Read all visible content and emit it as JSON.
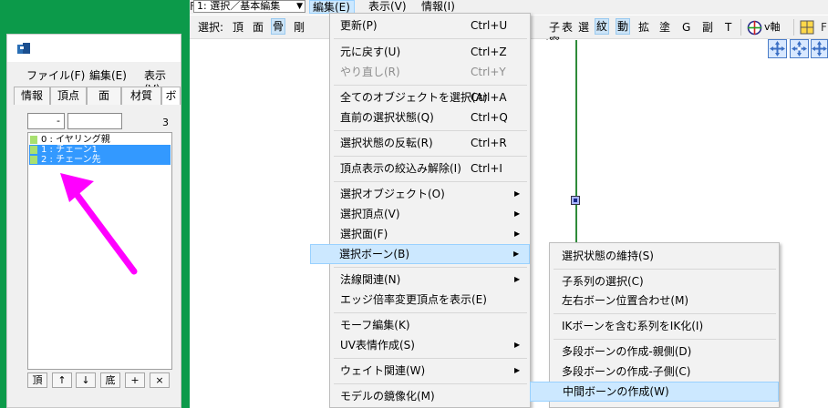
{
  "colors": {
    "green_bg": "#0c9a4a",
    "highlight": "#cce8ff",
    "list_selection": "#3399ff",
    "arrow": "#ff00ff",
    "axis": "#2e8b3a"
  },
  "topbar": {
    "mode_select": "1: 選択／基本編集",
    "menus": {
      "edit": "編集(E)",
      "view": "表示(V)",
      "info": "情報(I)"
    },
    "cut_left": "F",
    "cut_right": "F"
  },
  "select_toolbar": {
    "label": "選択:",
    "left": [
      "頂",
      "面",
      "骨",
      "剛"
    ],
    "window_label": "子窓:",
    "right": [
      "表",
      "選",
      "紋",
      "動",
      "拡",
      "塗",
      "G",
      "副",
      "T"
    ],
    "v_axis": "v軸"
  },
  "bone_panel": {
    "menus": [
      "ファイル(F)",
      "編集(E)",
      "表示(V)"
    ],
    "tabs": [
      "情報",
      "頂点",
      "面",
      "材質",
      "ボ"
    ],
    "field_a": "-",
    "field_b": "",
    "count": "3",
    "bones": [
      {
        "label": "0 : イヤリング親",
        "color": "#a8e070"
      },
      {
        "label": "1 : チェーン1",
        "color": "#a8e070"
      },
      {
        "label": "2 : チェーン先",
        "color": "#a8e070"
      }
    ],
    "buttons": [
      "頂",
      "↑",
      "↓",
      "底",
      "+",
      "×"
    ]
  },
  "edit_menu": {
    "items": [
      {
        "label": "更新(P)",
        "shortcut": "Ctrl+U"
      },
      {
        "label": "元に戻す(U)",
        "shortcut": "Ctrl+Z"
      },
      {
        "label": "やり直し(R)",
        "shortcut": "Ctrl+Y"
      },
      {
        "label": "全てのオブジェクトを選択(A)",
        "shortcut": "Ctrl+A"
      },
      {
        "label": "直前の選択状態(Q)",
        "shortcut": "Ctrl+Q"
      },
      {
        "label": "選択状態の反転(R)",
        "shortcut": "Ctrl+R"
      },
      {
        "label": "頂点表示の絞込み解除(I)",
        "shortcut": "Ctrl+I"
      },
      {
        "label": "選択オブジェクト(O)"
      },
      {
        "label": "選択頂点(V)"
      },
      {
        "label": "選択面(F)"
      },
      {
        "label": "選択ボーン(B)"
      },
      {
        "label": "法線関連(N)"
      },
      {
        "label": "エッジ倍率変更頂点を表示(E)"
      },
      {
        "label": "モーフ編集(K)"
      },
      {
        "label": "UV表情作成(S)"
      },
      {
        "label": "ウェイト関連(W)"
      },
      {
        "label": "モデルの鏡像化(M)"
      }
    ],
    "submenu_arrow": "▶"
  },
  "bone_submenu": {
    "items": [
      "選択状態の維持(S)",
      "子系列の選択(C)",
      "左右ボーン位置合わせ(M)",
      "IKボーンを含む系列をIK化(I)",
      "多段ボーンの作成-親側(D)",
      "多段ボーンの作成-子側(C)",
      "中間ボーンの作成(W)"
    ]
  }
}
